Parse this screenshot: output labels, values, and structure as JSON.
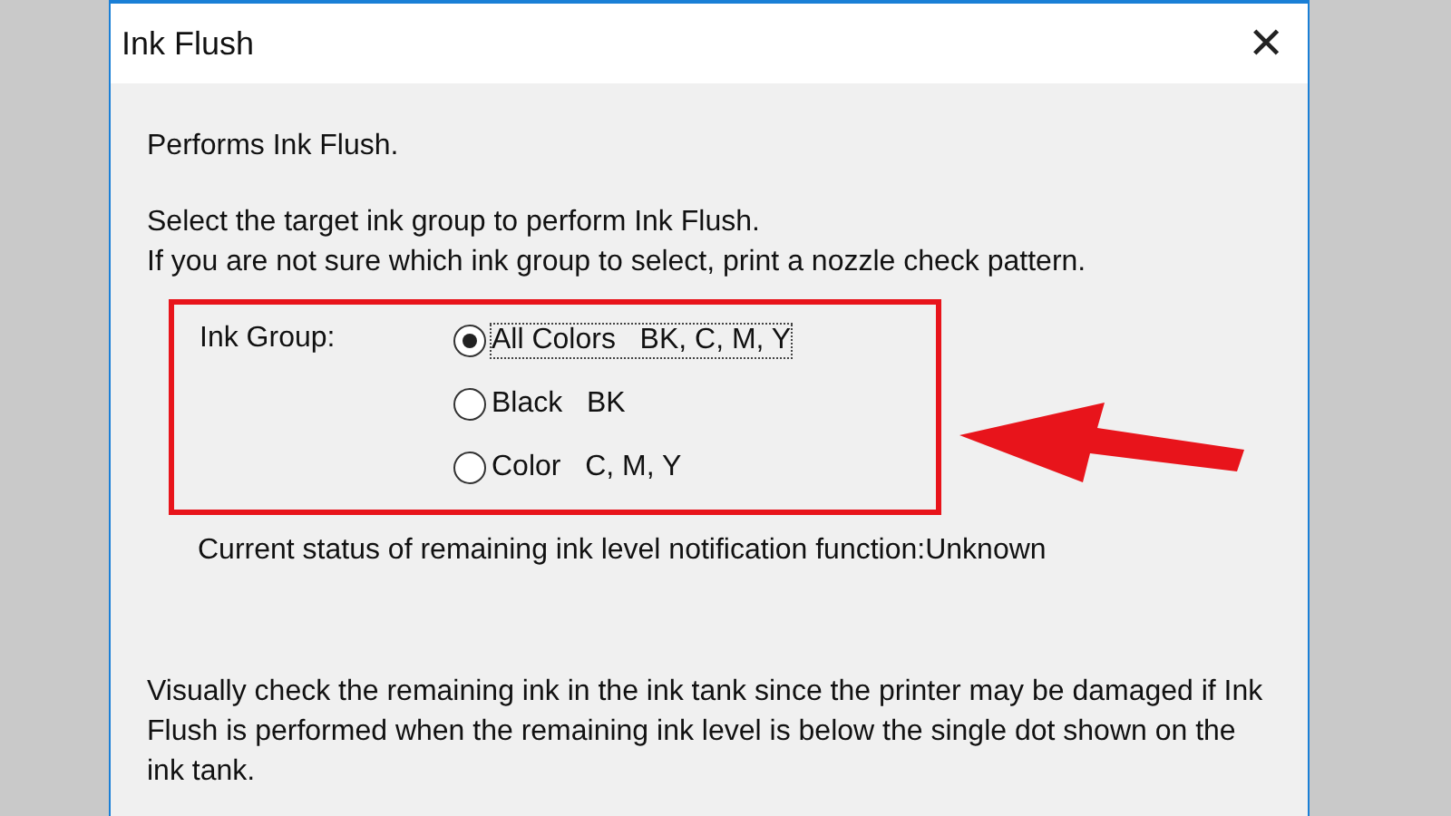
{
  "window": {
    "title": "Ink Flush",
    "close": "✕"
  },
  "intro": "Performs Ink Flush.",
  "instructions": [
    "Select the target ink group to perform Ink Flush.",
    "If you are not sure which ink group to select, print a nozzle check pattern."
  ],
  "ink_group": {
    "label": "Ink Group:",
    "options": [
      {
        "name": "All Colors",
        "inks": "BK, C, M, Y",
        "selected": true
      },
      {
        "name": "Black",
        "inks": "BK",
        "selected": false
      },
      {
        "name": "Color",
        "inks": "C, M, Y",
        "selected": false
      }
    ]
  },
  "status": "Current status of remaining ink level notification function:Unknown",
  "warning": "Visually check the remaining ink in the ink tank since the printer may be damaged if Ink Flush is performed when the remaining ink level is below the single dot shown on the ink tank."
}
